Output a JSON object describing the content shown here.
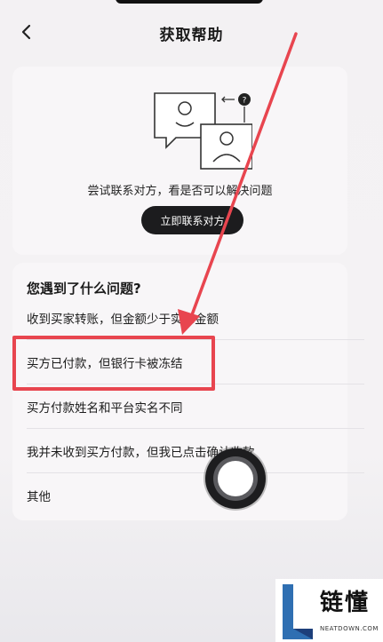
{
  "header": {
    "title": "获取帮助"
  },
  "contact_card": {
    "description": "尝试联系对方，看是否可以解决问题",
    "button_label": "立即联系对方"
  },
  "question_card": {
    "title": "您遇到了什么问题?",
    "items": [
      {
        "label": "收到买家转账，但金额少于实际金额"
      },
      {
        "label": "买方已付款，但银行卡被冻结"
      },
      {
        "label": "买方付款姓名和平台实名不同"
      },
      {
        "label": "我并未收到买方付款，但我已点击确认收款"
      },
      {
        "label": "其他"
      }
    ]
  },
  "annotation": {
    "color": "#e8454f"
  },
  "watermark": {
    "text": "链懂",
    "subtext": "NEATDOWN.COM"
  }
}
